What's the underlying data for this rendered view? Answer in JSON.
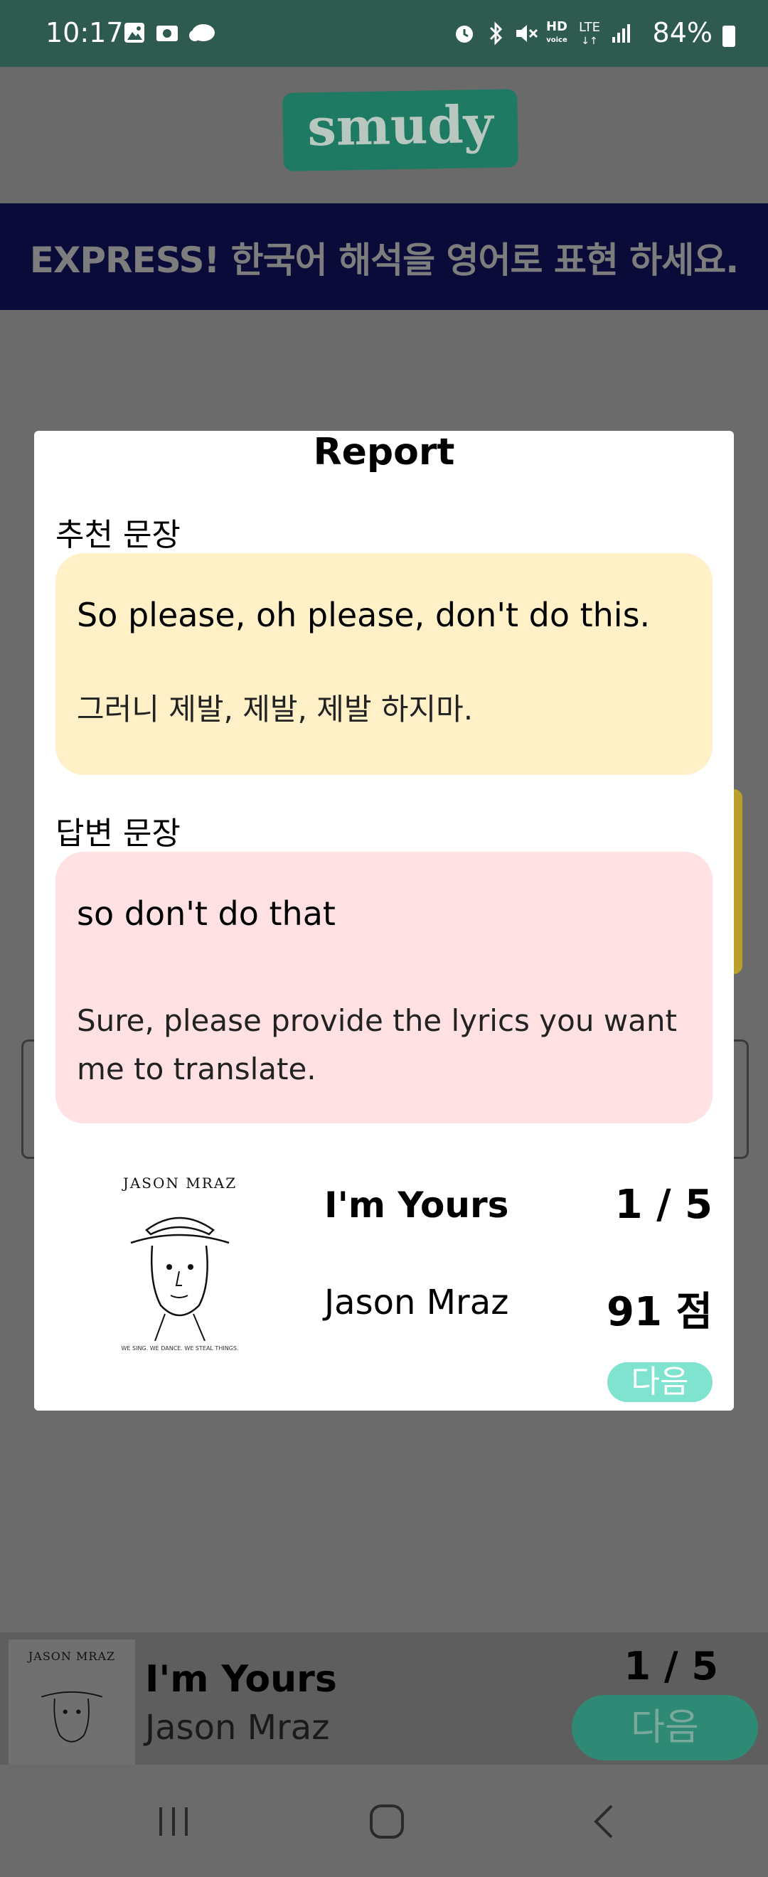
{
  "status_bar": {
    "time": "10:17",
    "battery": "84%",
    "left_icons": [
      "image-icon",
      "media-icon",
      "cloud-icon"
    ],
    "right_icons": [
      "alarm-icon",
      "bluetooth-icon",
      "mute-icon",
      "hd-voice-icon",
      "lte-icon",
      "signal-icon",
      "battery-icon"
    ],
    "hd_label": "HD",
    "lte_label": "LTE"
  },
  "header": {
    "logo": "smudy",
    "banner": "EXPRESS! 한국어 해석을 영어로 표현 하세요."
  },
  "report": {
    "title": "Report",
    "recommended": {
      "label": "추천 문장",
      "english": "So please, oh please, don't do this.",
      "korean": "그러니 제발, 제발, 제발 하지마."
    },
    "answer": {
      "label": "답변 문장",
      "english": "so don't do that",
      "feedback": "Sure, please provide the lyrics you want me to translate."
    },
    "song": {
      "title": "I'm Yours",
      "artist": "Jason Mraz",
      "progress": "1 / 5",
      "score": "91 점",
      "album_art_text": "JASON MRAZ",
      "album_art_caption": "WE SING. WE DANCE. WE STEAL THINGS."
    },
    "next_label": "다음"
  },
  "player": {
    "title": "I'm Yours",
    "artist": "Jason Mraz",
    "progress": "1 / 5",
    "next_label": "다음",
    "album_art_text": "JASON MRAZ"
  },
  "colors": {
    "status_bar": "#2e5a50",
    "banner": "#0b0b3a",
    "recommended_card": "#fff0c8",
    "answer_card": "#ffe1e3",
    "next_button": "#7fe3cf"
  }
}
